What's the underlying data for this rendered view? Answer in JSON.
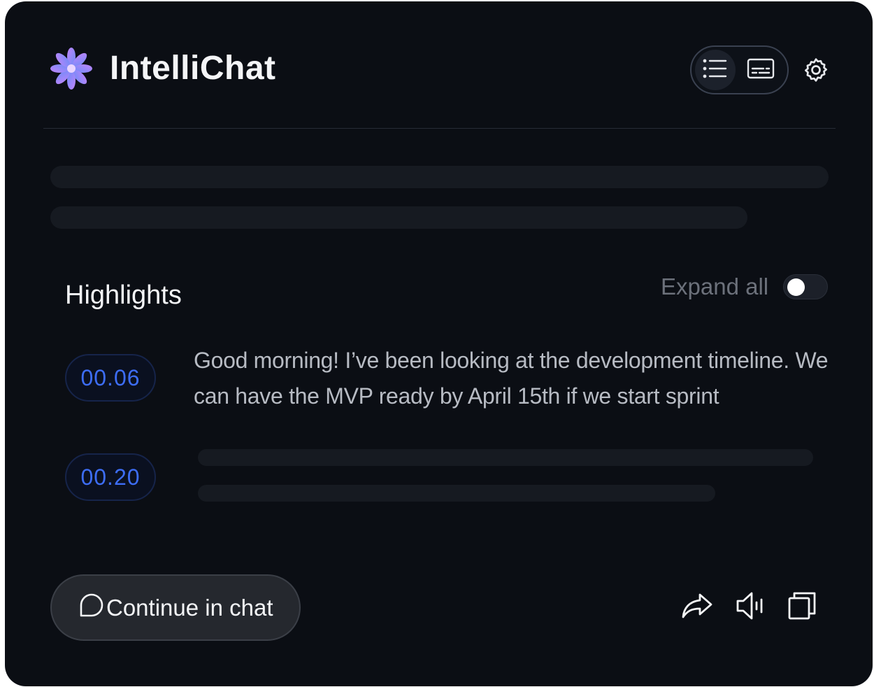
{
  "app": {
    "title": "IntelliChat",
    "logo_icon": "flower-logo-icon",
    "accent_color": "#8b5cf6"
  },
  "header": {
    "view_options": [
      {
        "icon": "list-icon",
        "active": true
      },
      {
        "icon": "subtitles-icon",
        "active": false
      }
    ],
    "settings_icon": "gear-icon"
  },
  "highlights": {
    "title": "Highlights",
    "expand_all_label": "Expand all",
    "expand_all_on": false,
    "items": [
      {
        "timestamp": "00.06",
        "text": "Good morning! I’ve been looking at the development timeline. We can have the MVP ready by April 15th if we start sprint"
      },
      {
        "timestamp": "00.20",
        "text": ""
      }
    ],
    "timestamp_color": "#3d6df5"
  },
  "footer": {
    "continue_label": "Continue in chat",
    "actions": [
      "share-icon",
      "speaker-icon",
      "copy-icon"
    ]
  }
}
